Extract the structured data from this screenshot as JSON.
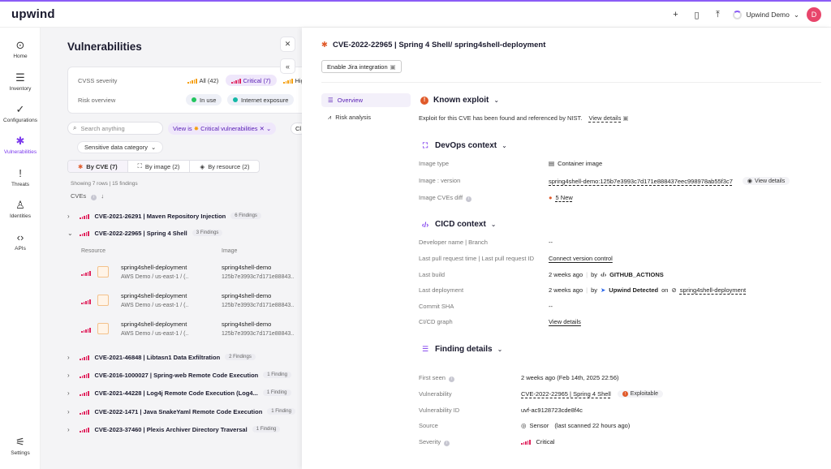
{
  "app": {
    "logo": "upwind"
  },
  "topbar": {
    "user_name": "Upwind Demo",
    "avatar_letter": "D"
  },
  "sidebar": [
    {
      "label": "Home",
      "icon": "home-icon"
    },
    {
      "label": "Inventory",
      "icon": "inventory-icon"
    },
    {
      "label": "Configurations",
      "icon": "check-icon"
    },
    {
      "label": "Vulnerabilities",
      "icon": "bug-icon"
    },
    {
      "label": "Threats",
      "icon": "alert-icon"
    },
    {
      "label": "Identities",
      "icon": "person-icon"
    },
    {
      "label": "APIs",
      "icon": "code-icon"
    },
    {
      "label": "Settings",
      "icon": "sliders-icon"
    }
  ],
  "left": {
    "title": "Vulnerabilities",
    "filters": {
      "cvss_label": "CVSS severity",
      "all_chip": "All (42)",
      "critical_chip": "Critical (7)",
      "high_chip": "High",
      "risk_label": "Risk overview",
      "in_use_chip": "In use",
      "exposure_chip": "Internet exposure"
    },
    "search_placeholder": "Search anything",
    "view_chip_prefix": "View is",
    "view_chip_value": "Critical vulnerabilities",
    "clear_chip": "Cl",
    "sensitive_data": "Sensitive data category",
    "tabs": [
      "By CVE (7)",
      "By image (2)",
      "By resource (2)"
    ],
    "showing": "Showing 7 rows | 15 findings",
    "cves_header": "CVEs",
    "rows": [
      {
        "name": "CVE-2021-26291 | Maven Repository Injection",
        "count": "6 Findings"
      },
      {
        "name": "CVE-2022-22965 | Spring 4 Shell",
        "count": "3 Findings"
      },
      {
        "name": "CVE-2021-46848 | Libtasn1 Data Exfiltration",
        "count": "2 Findings"
      },
      {
        "name": "CVE-2016-1000027 | Spring-web Remote Code Execution",
        "count": "1 Finding"
      },
      {
        "name": "CVE-2021-44228 | Log4j Remote Code Execution (Log4...",
        "count": "1 Finding"
      },
      {
        "name": "CVE-2022-1471 | Java SnakeYaml Remote Code Execution",
        "count": "1 Finding"
      },
      {
        "name": "CVE-2023-37460 | Plexis Archiver Directory Traversal",
        "count": "1 Finding"
      }
    ],
    "sub_headers": {
      "resource": "Resource",
      "image": "Image"
    },
    "resources": [
      {
        "name": "spring4shell-deployment",
        "sub": "AWS Demo /  us-east-1 / (..",
        "image": "spring4shell-demo",
        "image_sub": "125b7e3993c7d171e88843.."
      },
      {
        "name": "spring4shell-deployment",
        "sub": "AWS Demo /  us-east-1 / (..",
        "image": "spring4shell-demo",
        "image_sub": "125b7e3993c7d171e88843.."
      },
      {
        "name": "spring4shell-deployment",
        "sub": "AWS Demo /  us-east-1 / (..",
        "image": "spring4shell-demo",
        "image_sub": "125b7e3993c7d171e88843.."
      }
    ]
  },
  "detail": {
    "title": "CVE-2022-22965 | Spring 4 Shell/ spring4shell-deployment",
    "jira_button": "Enable Jira integration",
    "nav": [
      "Overview",
      "Risk analysis"
    ],
    "known_exploit": {
      "title": "Known exploit",
      "text": "Exploit for this CVE has been found and referenced by NIST.",
      "link": "View details"
    },
    "devops": {
      "title": "DevOps context",
      "image_type_label": "Image type",
      "image_type_value": "Container image",
      "image_version_label": "Image : version",
      "image_version_value": "spring4shell-demo:125b7e3993c7d171e888437eec998978ab55f3c7",
      "view_details": "View details",
      "image_cves_label": "Image CVEs diff",
      "image_cves_value": "5 New"
    },
    "cicd": {
      "title": "CICD context",
      "dev_label": "Developer name | Branch",
      "dev_value": "--",
      "lpr_label": "Last pull request time | Last pull request ID",
      "lpr_value": "Connect version control",
      "build_label": "Last build",
      "build_time": "2 weeks ago",
      "build_by": "by",
      "build_actor": "GITHUB_ACTIONS",
      "deploy_label": "Last deployment",
      "deploy_time": "2 weeks ago",
      "deploy_by": "by",
      "deploy_actor": "Upwind Detected",
      "deploy_on": "on",
      "deploy_target": "spring4shell-deployment",
      "sha_label": "Commit SHA",
      "sha_value": "--",
      "graph_label": "CI/CD graph",
      "graph_value": "View details"
    },
    "finding": {
      "title": "Finding details",
      "first_seen_label": "First seen",
      "first_seen_value": "2 weeks ago (Feb 14th, 2025 22:56)",
      "vuln_label": "Vulnerability",
      "vuln_value": "CVE-2022-22965 | Spring 4 Shell",
      "exploitable": "Exploitable",
      "vuln_id_label": "Vulnerability ID",
      "vuln_id_value": "uvf-ac9128723cde8f4c",
      "source_label": "Source",
      "source_value": "Sensor",
      "source_note": "(last scanned 22 hours ago)",
      "severity_label": "Severity",
      "severity_value": "Critical"
    }
  },
  "colors": {
    "accent": "#7c3aed",
    "critical": "#e0245e",
    "exploit": "#e05a2a"
  }
}
